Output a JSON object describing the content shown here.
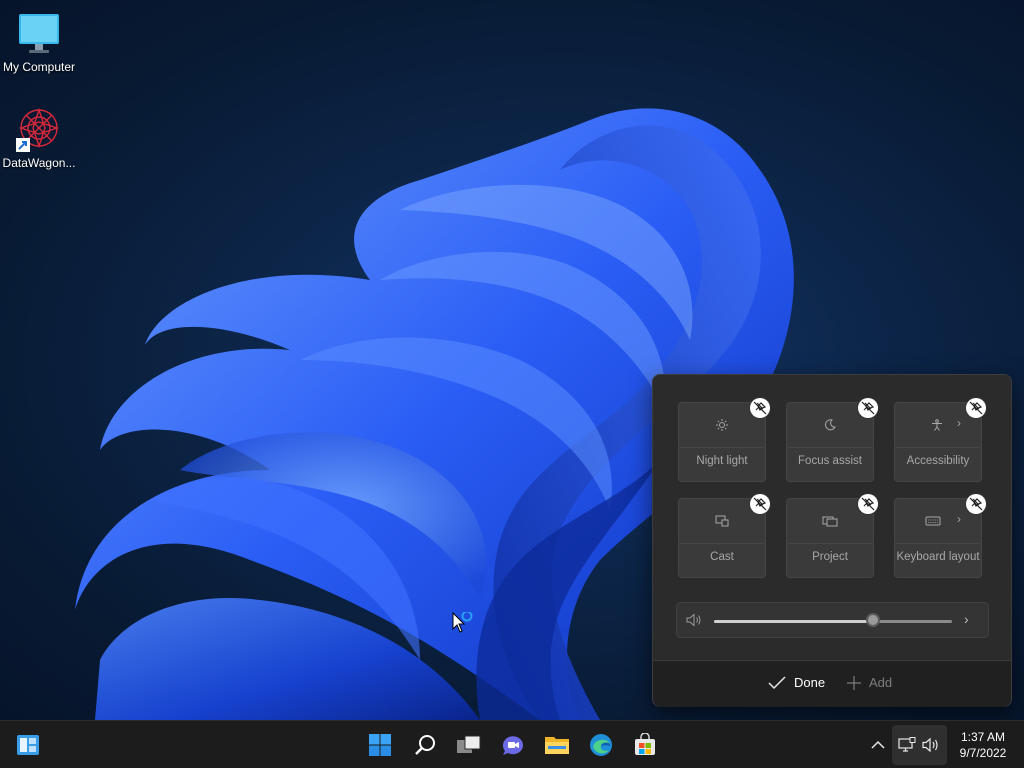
{
  "desktop": {
    "icons": [
      {
        "label": "My Computer",
        "icon": "monitor-icon"
      },
      {
        "label": "DataWagon...",
        "icon": "datawagon-shortcut-icon"
      }
    ]
  },
  "quick_settings": {
    "tiles": [
      {
        "label": "Night light",
        "icon": "night-light-icon",
        "has_chevron": false
      },
      {
        "label": "Focus assist",
        "icon": "moon-icon",
        "has_chevron": false
      },
      {
        "label": "Accessibility",
        "icon": "accessibility-icon",
        "has_chevron": true
      },
      {
        "label": "Cast",
        "icon": "cast-icon",
        "has_chevron": false
      },
      {
        "label": "Project",
        "icon": "project-icon",
        "has_chevron": false
      },
      {
        "label": "Keyboard layout",
        "icon": "keyboard-icon",
        "has_chevron": true
      }
    ],
    "volume": {
      "level": 0.67
    },
    "done_label": "Done",
    "add_label": "Add"
  },
  "taskbar": {
    "left_icon": "widgets-icon",
    "apps": [
      "start-icon",
      "search-icon",
      "task-view-icon",
      "chat-icon",
      "file-explorer-icon",
      "edge-icon",
      "store-icon"
    ],
    "tray": [
      "chevron-up-icon",
      "network-icon",
      "volume-icon"
    ],
    "time": "1:37 AM",
    "date": "9/7/2022"
  },
  "colors": {
    "panel_bg": "#2b2b2b",
    "tile_bg": "#3a3a3a",
    "taskbar_bg": "#1c1c1c",
    "accent_blue": "#2f6fff"
  }
}
